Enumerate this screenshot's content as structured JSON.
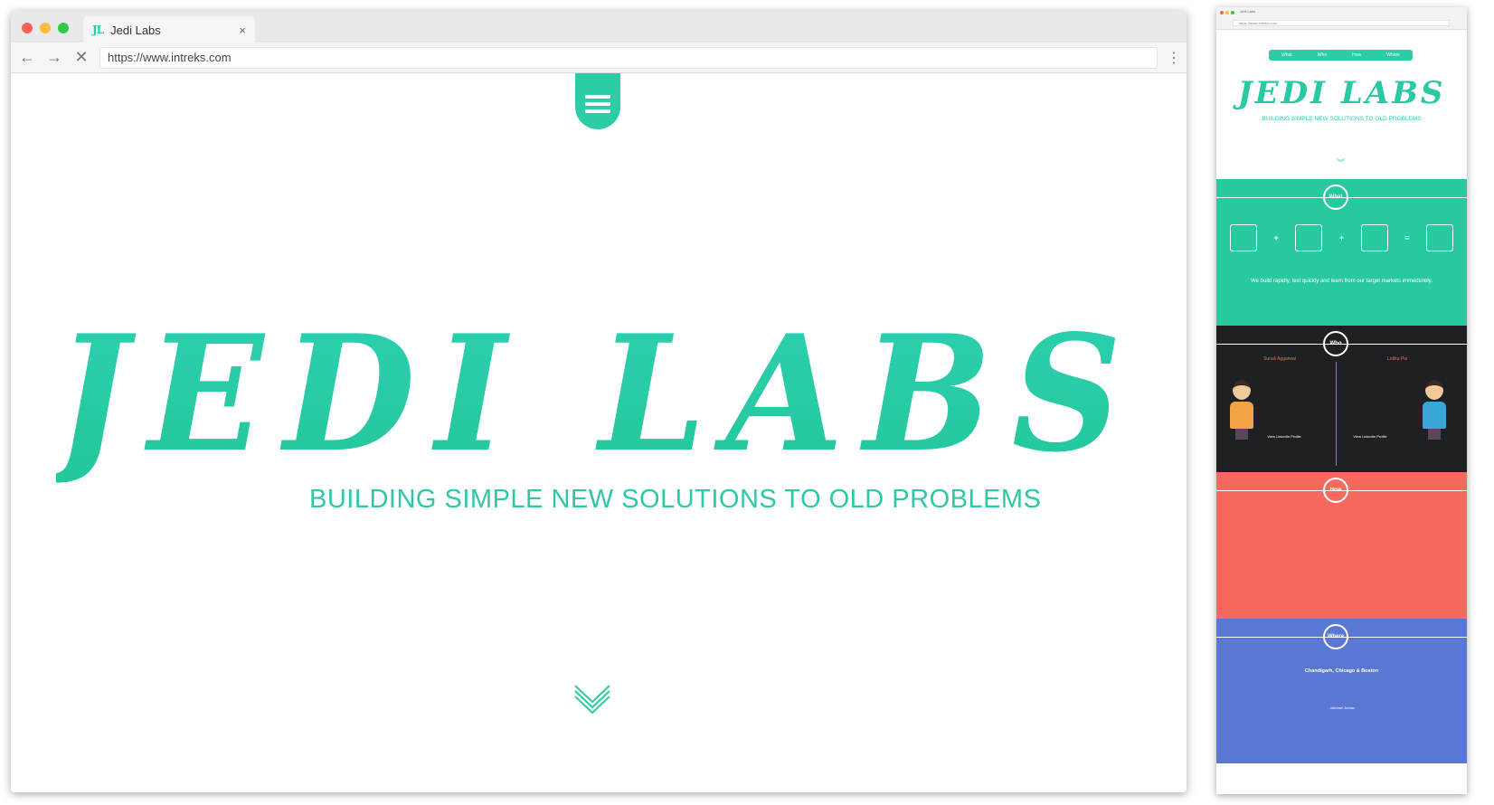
{
  "browser": {
    "tab_logo": "JL",
    "tab_title": "Jedi Labs",
    "tab_close": "×",
    "back": "←",
    "forward": "→",
    "stop": "✕",
    "url": "https://www.intreks.com",
    "menu": "⋮"
  },
  "hero": {
    "logo_text": "JEDI LABS",
    "tagline": "BUILDING SIMPLE NEW SOLUTIONS TO OLD PROBLEMS",
    "brand_color": "#2ccca6"
  },
  "mini": {
    "tab_title": "Jedi Labs",
    "url": "https://www.intreks.com",
    "nav": [
      "What",
      "Who",
      "How",
      "Where"
    ],
    "logo_text": "JEDI LABS",
    "tagline": "BUILDING SIMPLE NEW SOLUTIONS TO OLD PROBLEMS",
    "what": {
      "badge": "What",
      "headline": "We build rapidly, test quickly and learn from our target markets immediately.",
      "color": "#28c99f"
    },
    "who": {
      "badge": "Who",
      "person1_name": "Sunali Aggarwal",
      "person2_name": "Lotika Pai",
      "person1_link": "View LinkedIn Profile",
      "person2_link": "View LinkedIn Profile",
      "color": "#1e2023"
    },
    "how": {
      "badge": "How",
      "color": "#f7685f"
    },
    "where": {
      "badge": "Where",
      "location": "Chandigarh, Chicago & Boston",
      "attribution": "- Michael Jordan",
      "color": "#5a77d3"
    }
  }
}
